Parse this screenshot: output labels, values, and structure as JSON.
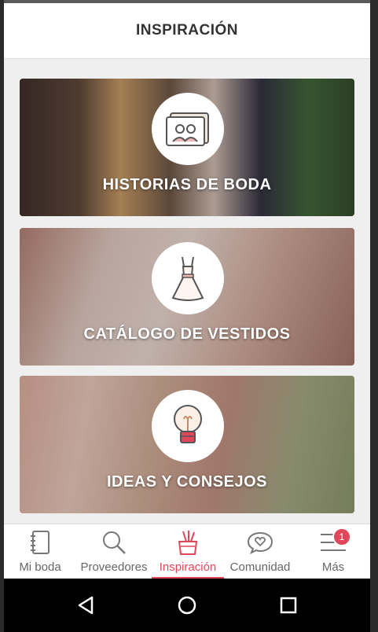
{
  "header": {
    "title": "INSPIRACIÓN"
  },
  "cards": [
    {
      "label": "HISTORIAS DE BODA",
      "icon": "photo-album-icon"
    },
    {
      "label": "CATÁLOGO DE VESTIDOS",
      "icon": "dress-icon"
    },
    {
      "label": "IDEAS Y CONSEJOS",
      "icon": "lightbulb-icon"
    }
  ],
  "tabs": [
    {
      "label": "Mi boda",
      "icon": "notebook-icon"
    },
    {
      "label": "Proveedores",
      "icon": "search-icon"
    },
    {
      "label": "Inspiración",
      "icon": "pencil-cup-icon",
      "active": true
    },
    {
      "label": "Comunidad",
      "icon": "chat-heart-icon"
    },
    {
      "label": "Más",
      "icon": "menu-icon",
      "badge": "1"
    }
  ],
  "colors": {
    "accent": "#e0475a",
    "header_bg": "#ffffff",
    "page_bg": "#efefef"
  }
}
